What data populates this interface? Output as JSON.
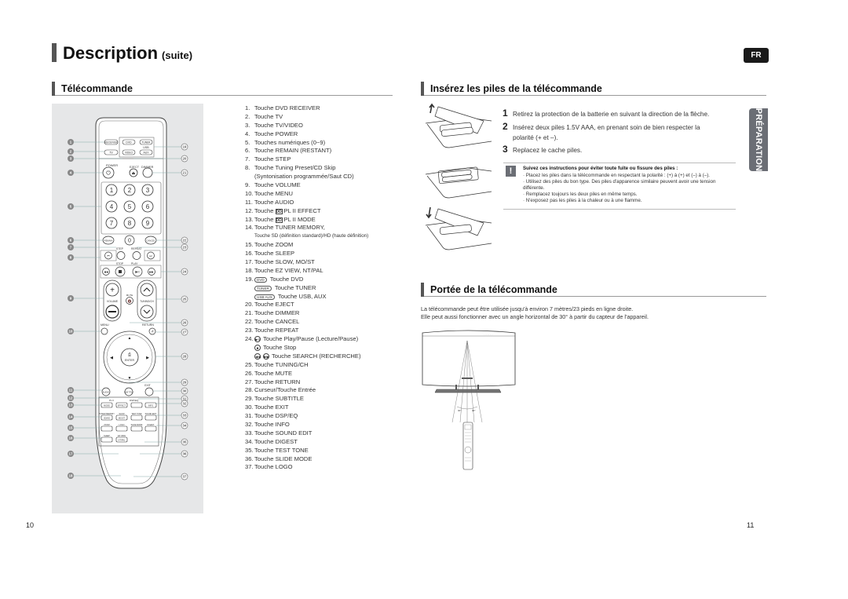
{
  "header": {
    "title": "Description",
    "title_suffix": "(suite)",
    "lang_badge": "FR",
    "side_tab": "PRÉPARATION"
  },
  "remote_section": {
    "heading": "Télécommande",
    "remote_labels": {
      "receiver": "RECEIVER",
      "dvd": "DVD",
      "tuner": "TUNER",
      "usb": "USB",
      "aux": "AUX",
      "tv": "TV",
      "video": "VIDEO",
      "power": "POWER",
      "eject": "EJECT",
      "dimmer": "DIMMER",
      "digits": [
        "1",
        "2",
        "3",
        "4",
        "5",
        "6",
        "7",
        "8",
        "9",
        "0"
      ],
      "remain": "REMAIN",
      "cancel": "CANCEL",
      "step": "STEP",
      "repeat": "REPEAT",
      "stop": "STOP",
      "play": "PLAY",
      "volume": "VOLUME",
      "mute": "MUTE",
      "tuning_ch": "TUNING/CH",
      "menu": "MENU",
      "return": "RETURN",
      "enter": "ENTER",
      "audio": "AUDIO",
      "subtitle": "SUB TITLE",
      "exit": "EXIT",
      "pl2": "PL II",
      "mode": "MODE",
      "effect": "EFFECT",
      "dsp_eq": "DSP/EQ",
      "info": "INFO",
      "tuner_memory": "TUNER MEMORY",
      "sd_hd": "SD/HD",
      "slow": "SLOW",
      "mo_st": "MO/ST",
      "test_tone": "TEST TONE",
      "sound_edit": "SOUND EDIT",
      "zoom": "ZOOM",
      "logo": "LOGO",
      "slide_mode": "SLIDE MODE",
      "digest": "DIGEST",
      "sleep": "SLEEP",
      "ez_view": "EZ VIEW",
      "nt_pal": "NT/PAL"
    },
    "callouts_left": [
      "1",
      "2",
      "3",
      "4",
      "5",
      "6",
      "7",
      "8",
      "9",
      "10",
      "11",
      "12",
      "13",
      "14",
      "15",
      "16",
      "17",
      "18"
    ],
    "callouts_right": [
      "19",
      "20",
      "21",
      "22",
      "23",
      "24",
      "25",
      "26",
      "27",
      "28",
      "29",
      "30",
      "31",
      "32",
      "33",
      "34",
      "35",
      "36",
      "37"
    ],
    "items": [
      {
        "num": "1.",
        "text": "Touche DVD RECEIVER"
      },
      {
        "num": "2.",
        "text": "Touche TV"
      },
      {
        "num": "3.",
        "text": "Touche TV/VIDEO"
      },
      {
        "num": "4.",
        "text": "Touche POWER"
      },
      {
        "num": "5.",
        "text": "Touches numériques (0~9)"
      },
      {
        "num": "6.",
        "text": "Touche REMAIN (RESTANT)"
      },
      {
        "num": "7.",
        "text": "Touche STEP"
      },
      {
        "num": "8.",
        "text": "Touche Tuning Preset/CD Skip"
      },
      {
        "num": "",
        "text": "(Syntonisation programmée/Saut CD)"
      },
      {
        "num": "9.",
        "text": "Touche VOLUME"
      },
      {
        "num": "10.",
        "text": "Touche MENU"
      },
      {
        "num": "11.",
        "text": "Touche AUDIO"
      },
      {
        "num": "12.",
        "text_pre": "Touche",
        "icon": "DD",
        "text": "PL II EFFECT"
      },
      {
        "num": "13.",
        "text_pre": "Touche",
        "icon": "DD",
        "text": "PL II MODE"
      },
      {
        "num": "14.",
        "text": "Touche TUNER MEMORY,"
      },
      {
        "num": "",
        "text": "Touche SD (définition standard)/HD (haute définition)"
      },
      {
        "num": "15.",
        "text": "Touche ZOOM"
      },
      {
        "num": "16.",
        "text": "Touche SLEEP"
      },
      {
        "num": "17.",
        "text": "Touche SLOW, MO/ST"
      },
      {
        "num": "18.",
        "text": "Touche EZ VIEW, NT/PAL"
      },
      {
        "num": "19.",
        "chip": "DVD",
        "text": "Touche DVD"
      },
      {
        "num": "",
        "chip": "TUNER",
        "text": "Touche TUNER"
      },
      {
        "num": "",
        "chip": "USB AUX",
        "text": "Touche USB, AUX"
      },
      {
        "num": "20.",
        "text": "Touche EJECT"
      },
      {
        "num": "21.",
        "text": "Touche DIMMER"
      },
      {
        "num": "22.",
        "text": "Touche CANCEL"
      },
      {
        "num": "23.",
        "text": "Touche REPEAT"
      },
      {
        "num": "24.",
        "circ": "▶II",
        "text": "Touche Play/Pause (Lecture/Pause)"
      },
      {
        "num": "",
        "circ": "■",
        "text": "Touche Stop"
      },
      {
        "num": "",
        "circ": "◀◀",
        "circ2": "▶▶",
        "text": "Touche SEARCH (RECHERCHE)"
      },
      {
        "num": "25.",
        "text": "Touche TUNING/CH"
      },
      {
        "num": "26.",
        "text": "Touche MUTE"
      },
      {
        "num": "27.",
        "text": "Touche RETURN"
      },
      {
        "num": "28.",
        "text": "Curseur/Touche Entrée"
      },
      {
        "num": "29.",
        "text": "Touche SUBTITLE"
      },
      {
        "num": "30.",
        "text": "Touche EXIT"
      },
      {
        "num": "31.",
        "text": "Touche DSP/EQ"
      },
      {
        "num": "32.",
        "text": "Touche INFO"
      },
      {
        "num": "33.",
        "text": "Touche SOUND EDIT"
      },
      {
        "num": "34.",
        "text": "Touche DIGEST"
      },
      {
        "num": "35.",
        "text": "Touche TEST TONE"
      },
      {
        "num": "36.",
        "text": "Touche SLIDE MODE"
      },
      {
        "num": "37.",
        "text": "Touche LOGO"
      }
    ]
  },
  "battery_section": {
    "heading": "Insérez les piles de la télécommande",
    "steps": [
      {
        "n": "1",
        "text": "Retirez la protection de la batterie en suivant la direction de la flèche."
      },
      {
        "n": "2",
        "text": "Insérez deux piles 1.5V AAA, en prenant soin de bien respecter la polarité (+ et –)."
      },
      {
        "n": "3",
        "text": "Replacez le cache piles."
      }
    ],
    "note": {
      "icon": "!",
      "title": "Suivez ces instructions pour éviter toute fuite ou fissure des piles :",
      "bullets": [
        "Placez les piles dans la télécommande en respectant la polarité : (+) à (+) et (–) à (–).",
        "Utilisez des piles du bon type. Des piles d'apparence similaire peuvent avoir une tension différente.",
        "Remplacez toujours les deux piles en même temps.",
        "N'exposez pas les piles à la chaleur ou à une flamme."
      ]
    }
  },
  "range_section": {
    "heading": "Portée de la télécommande",
    "lines": [
      "La télécommande peut être utilisée jusqu'à environ 7 mètres/23 pieds en ligne droite.",
      "Elle peut aussi fonctionner avec un angle horizontal de 30° à partir du capteur de l'appareil."
    ],
    "angle_left": "30°",
    "angle_right": "30°"
  },
  "footer": {
    "page_left": "10",
    "page_right": "11"
  }
}
